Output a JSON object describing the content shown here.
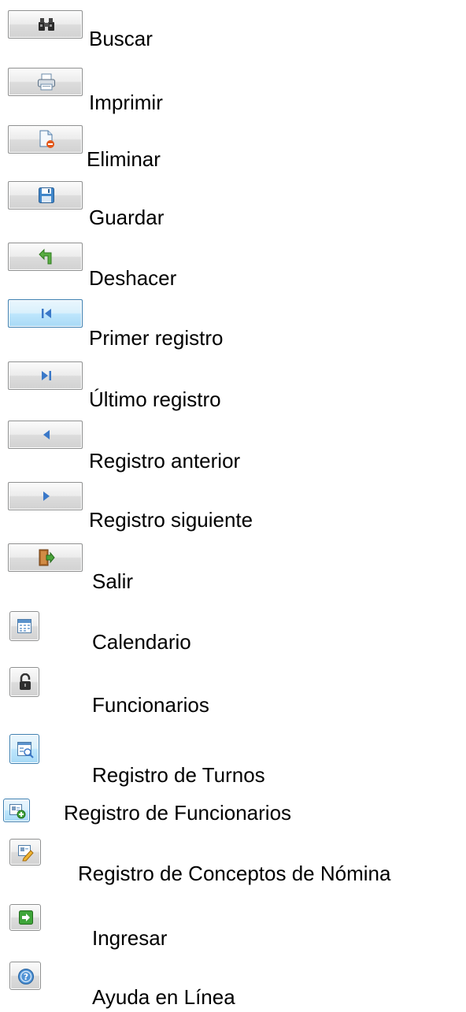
{
  "items": [
    {
      "label": "Buscar",
      "icon": "binoculars-icon"
    },
    {
      "label": "Imprimir",
      "icon": "printer-icon"
    },
    {
      "label": "Eliminar",
      "icon": "delete-document-icon"
    },
    {
      "label": "Guardar",
      "icon": "floppy-disk-icon"
    },
    {
      "label": "Deshacer",
      "icon": "undo-arrow-icon"
    },
    {
      "label": "Primer registro",
      "icon": "first-record-icon"
    },
    {
      "label": "Último registro",
      "icon": "last-record-icon"
    },
    {
      "label": "Registro anterior",
      "icon": "previous-record-icon"
    },
    {
      "label": "Registro siguiente",
      "icon": "next-record-icon"
    },
    {
      "label": "Salir",
      "icon": "exit-door-icon"
    },
    {
      "label": "Calendario",
      "icon": "calendar-icon"
    },
    {
      "label": "Funcionarios",
      "icon": "padlock-icon"
    },
    {
      "label": "Registro de Turnos",
      "icon": "form-search-icon"
    },
    {
      "label": "Registro de Funcionarios",
      "icon": "add-user-card-icon"
    },
    {
      "label": "Registro de Conceptos de Nómina",
      "icon": "edit-card-icon"
    },
    {
      "label": "Ingresar",
      "icon": "enter-arrow-icon"
    },
    {
      "label": "Ayuda en Línea",
      "icon": "help-icon"
    }
  ]
}
